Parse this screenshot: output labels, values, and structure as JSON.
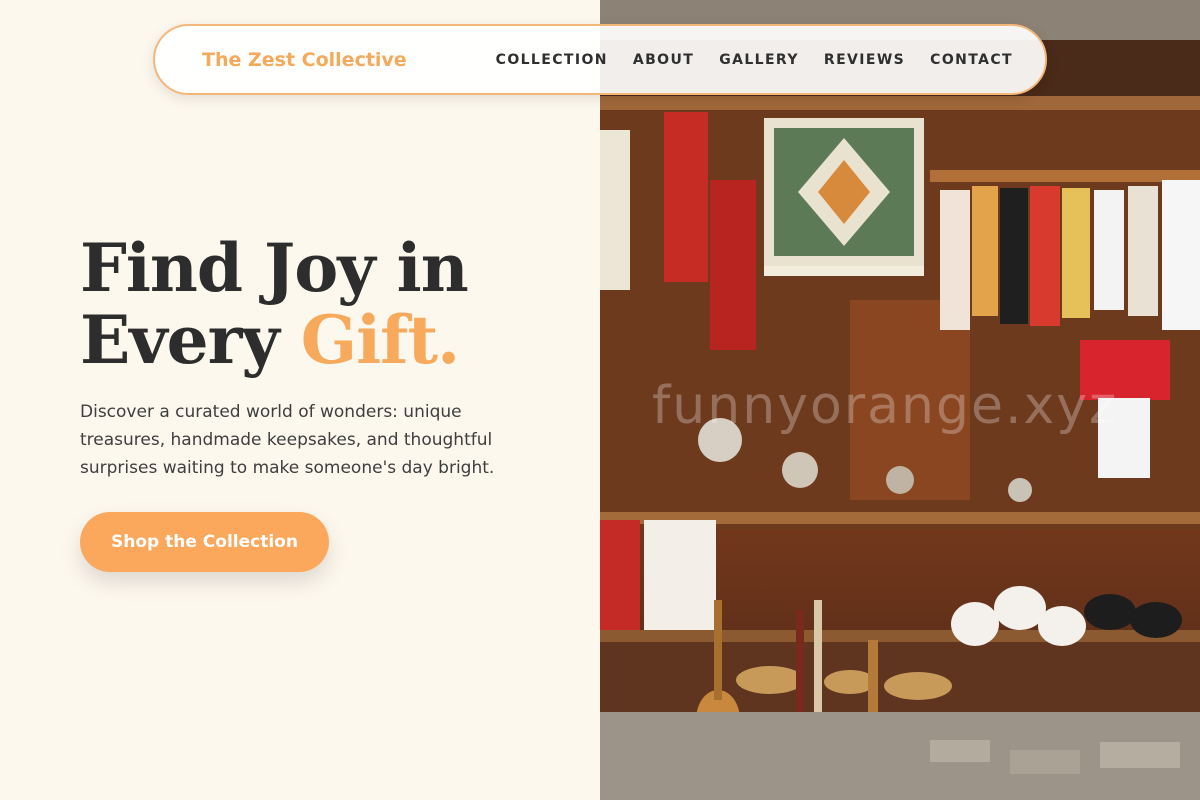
{
  "nav": {
    "brand": "The Zest Collective",
    "items": [
      {
        "label": "COLLECTION"
      },
      {
        "label": "ABOUT"
      },
      {
        "label": "GALLERY"
      },
      {
        "label": "REVIEWS"
      },
      {
        "label": "CONTACT"
      }
    ]
  },
  "hero": {
    "title_line1": "Find Joy in",
    "title_line2_prefix": "Every ",
    "title_accent": "Gift.",
    "subtitle": "Discover a curated world of wonders: unique treasures, handmade keepsakes, and thoughtful surprises waiting to make someone's day bright.",
    "cta_label": "Shop the Collection"
  },
  "photo": {
    "watermark": "funnyorange.xyz"
  },
  "colors": {
    "accent": "#f7a95c",
    "background": "#fdf8ee",
    "text": "#2d2d2d"
  }
}
